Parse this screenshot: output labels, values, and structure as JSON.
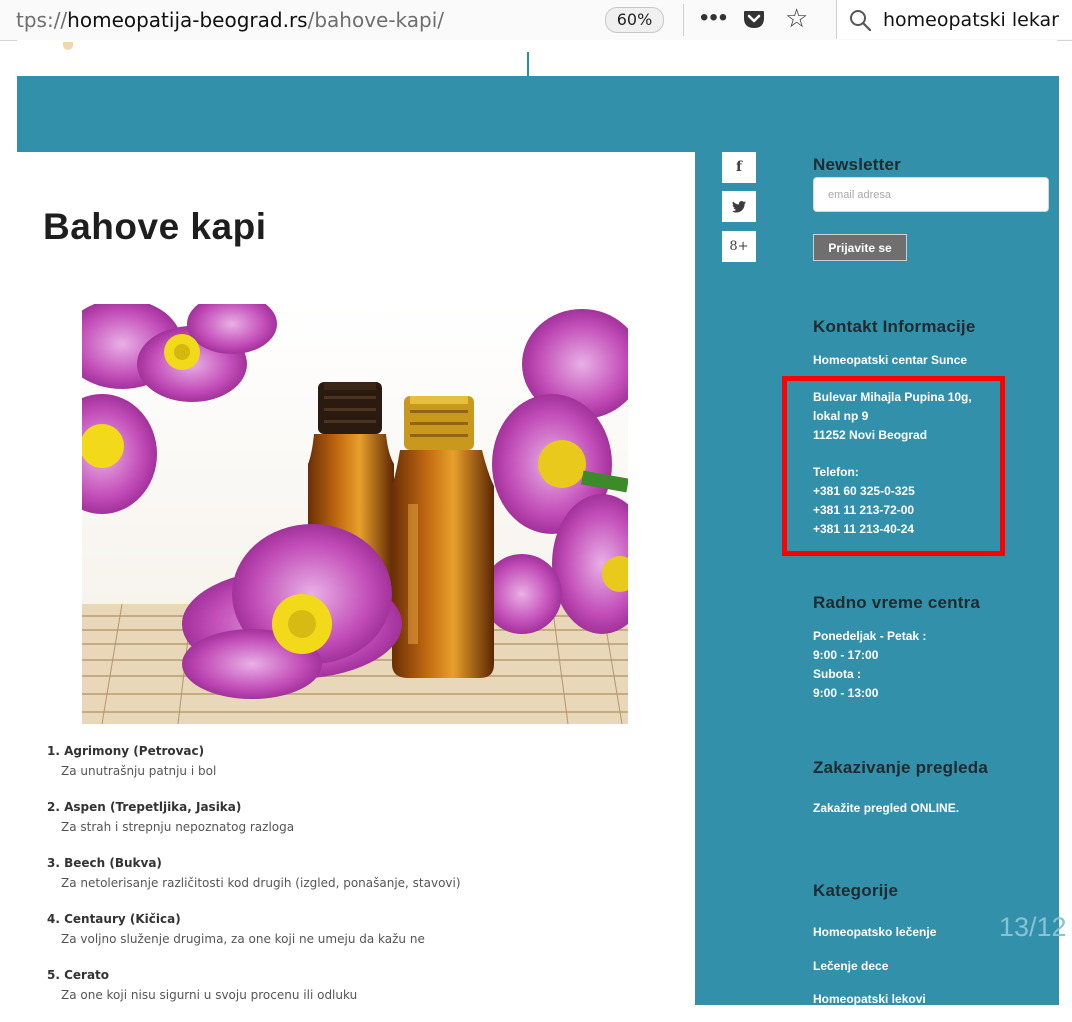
{
  "browser": {
    "url_prefix": "tps://",
    "url_domain": "homeopatija-beograd.rs",
    "url_path": "/bahove-kapi/",
    "zoom": "60%",
    "menu_icon": "ellipsis-icon",
    "search_value": "homeopatski lekar"
  },
  "article": {
    "title": "Bahove kapi",
    "remedies": [
      {
        "name": "1. Agrimony (Petrovac)",
        "desc": "Za unutrašnju patnju i bol"
      },
      {
        "name": "2. Aspen (Trepetljika, Jasika)",
        "desc": "Za strah i strepnju nepoznatog razloga"
      },
      {
        "name": "3. Beech (Bukva)",
        "desc": "Za netolerisanje različitosti kod drugih (izgled, ponašanje, stavovi)"
      },
      {
        "name": "4. Centaury (Kičica)",
        "desc": "Za voljno služenje drugima, za one koji ne umeju da kažu ne"
      },
      {
        "name": "5. Cerato",
        "desc": "Za one koji nisu sigurni u svoju procenu ili odluku"
      }
    ]
  },
  "social": {
    "facebook": "f",
    "twitter_icon": "twitter-icon",
    "google_plus": "8+"
  },
  "sidebar": {
    "newsletter": {
      "title": "Newsletter",
      "placeholder": "email adresa",
      "button": "Prijavite se"
    },
    "contact": {
      "title": "Kontakt Informacije",
      "name": "Homeopatski centar Sunce",
      "address1": "Bulevar Mihajla Pupina 10g,",
      "address2": "lokal np 9",
      "address3": "11252 Novi Beograd",
      "phone_label": "Telefon:",
      "phone1": "+381 60 325-0-325",
      "phone2": "+381 11 213-72-00",
      "phone3": "+381 11 213-40-24"
    },
    "hours": {
      "title": "Radno vreme centra",
      "weekday_label": "Ponedeljak - Petak :",
      "weekday_hours": "9:00 - 17:00",
      "saturday_label": "Subota :",
      "saturday_hours": "9:00 - 13:00"
    },
    "booking": {
      "title": "Zakazivanje pregleda",
      "link": "Zakažite pregled ONLINE."
    },
    "categories": {
      "title": "Kategorije",
      "items": [
        "Homeopatsko lečenje",
        "Lečenje dece",
        "Homeopatski lekovi"
      ]
    }
  },
  "overlay": {
    "page_counter": "13/12",
    "highlight_color": "#ff0000"
  },
  "colors": {
    "brand_teal": "#3390aa",
    "sidebar_heading": "#1f2b30"
  }
}
